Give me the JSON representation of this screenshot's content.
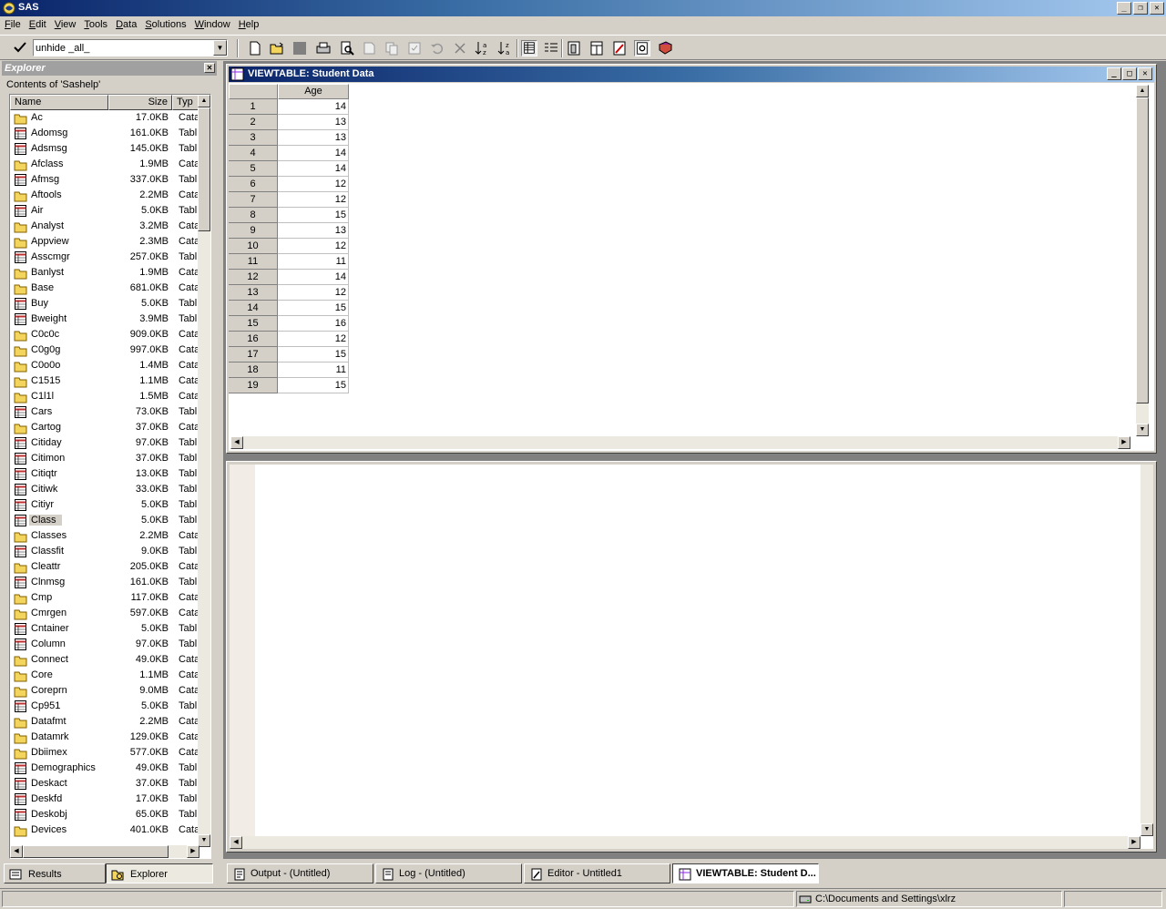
{
  "app": {
    "title": "SAS"
  },
  "menu": [
    {
      "pre": "",
      "u": "F",
      "post": "ile"
    },
    {
      "pre": "",
      "u": "E",
      "post": "dit"
    },
    {
      "pre": "",
      "u": "V",
      "post": "iew"
    },
    {
      "pre": "",
      "u": "T",
      "post": "ools"
    },
    {
      "pre": "",
      "u": "D",
      "post": "ata"
    },
    {
      "pre": "",
      "u": "S",
      "post": "olutions"
    },
    {
      "pre": "",
      "u": "W",
      "post": "indow"
    },
    {
      "pre": "",
      "u": "H",
      "post": "elp"
    }
  ],
  "command": {
    "value": "unhide _all_"
  },
  "explorer": {
    "title": "Explorer",
    "subtitle": "Contents of 'Sashelp'",
    "columns": {
      "name": "Name",
      "size": "Size",
      "type": "Typ"
    },
    "items": [
      {
        "name": "Ac",
        "size": "17.0KB",
        "type": "Cata",
        "kind": "folder"
      },
      {
        "name": "Adomsg",
        "size": "161.0KB",
        "type": "Tabl",
        "kind": "table"
      },
      {
        "name": "Adsmsg",
        "size": "145.0KB",
        "type": "Tabl",
        "kind": "table"
      },
      {
        "name": "Afclass",
        "size": "1.9MB",
        "type": "Cata",
        "kind": "folder"
      },
      {
        "name": "Afmsg",
        "size": "337.0KB",
        "type": "Tabl",
        "kind": "table"
      },
      {
        "name": "Aftools",
        "size": "2.2MB",
        "type": "Cata",
        "kind": "folder"
      },
      {
        "name": "Air",
        "size": "5.0KB",
        "type": "Tabl",
        "kind": "table"
      },
      {
        "name": "Analyst",
        "size": "3.2MB",
        "type": "Cata",
        "kind": "folder"
      },
      {
        "name": "Appview",
        "size": "2.3MB",
        "type": "Cata",
        "kind": "folder"
      },
      {
        "name": "Asscmgr",
        "size": "257.0KB",
        "type": "Tabl",
        "kind": "table"
      },
      {
        "name": "Banlyst",
        "size": "1.9MB",
        "type": "Cata",
        "kind": "folder"
      },
      {
        "name": "Base",
        "size": "681.0KB",
        "type": "Cata",
        "kind": "folder"
      },
      {
        "name": "Buy",
        "size": "5.0KB",
        "type": "Tabl",
        "kind": "table"
      },
      {
        "name": "Bweight",
        "size": "3.9MB",
        "type": "Tabl",
        "kind": "table"
      },
      {
        "name": "C0c0c",
        "size": "909.0KB",
        "type": "Cata",
        "kind": "folder"
      },
      {
        "name": "C0g0g",
        "size": "997.0KB",
        "type": "Cata",
        "kind": "folder"
      },
      {
        "name": "C0o0o",
        "size": "1.4MB",
        "type": "Cata",
        "kind": "folder"
      },
      {
        "name": "C1515",
        "size": "1.1MB",
        "type": "Cata",
        "kind": "folder"
      },
      {
        "name": "C1l1l",
        "size": "1.5MB",
        "type": "Cata",
        "kind": "folder"
      },
      {
        "name": "Cars",
        "size": "73.0KB",
        "type": "Tabl",
        "kind": "table"
      },
      {
        "name": "Cartog",
        "size": "37.0KB",
        "type": "Cata",
        "kind": "folder"
      },
      {
        "name": "Citiday",
        "size": "97.0KB",
        "type": "Tabl",
        "kind": "table"
      },
      {
        "name": "Citimon",
        "size": "37.0KB",
        "type": "Tabl",
        "kind": "table"
      },
      {
        "name": "Citiqtr",
        "size": "13.0KB",
        "type": "Tabl",
        "kind": "table"
      },
      {
        "name": "Citiwk",
        "size": "33.0KB",
        "type": "Tabl",
        "kind": "table"
      },
      {
        "name": "Citiyr",
        "size": "5.0KB",
        "type": "Tabl",
        "kind": "table"
      },
      {
        "name": "Class",
        "size": "5.0KB",
        "type": "Tabl",
        "kind": "table",
        "selected": true
      },
      {
        "name": "Classes",
        "size": "2.2MB",
        "type": "Cata",
        "kind": "folder"
      },
      {
        "name": "Classfit",
        "size": "9.0KB",
        "type": "Tabl",
        "kind": "table"
      },
      {
        "name": "Cleattr",
        "size": "205.0KB",
        "type": "Cata",
        "kind": "folder"
      },
      {
        "name": "Clnmsg",
        "size": "161.0KB",
        "type": "Tabl",
        "kind": "table"
      },
      {
        "name": "Cmp",
        "size": "117.0KB",
        "type": "Cata",
        "kind": "folder"
      },
      {
        "name": "Cmrgen",
        "size": "597.0KB",
        "type": "Cata",
        "kind": "folder"
      },
      {
        "name": "Cntainer",
        "size": "5.0KB",
        "type": "Tabl",
        "kind": "table"
      },
      {
        "name": "Column",
        "size": "97.0KB",
        "type": "Tabl",
        "kind": "table"
      },
      {
        "name": "Connect",
        "size": "49.0KB",
        "type": "Cata",
        "kind": "folder"
      },
      {
        "name": "Core",
        "size": "1.1MB",
        "type": "Cata",
        "kind": "folder"
      },
      {
        "name": "Coreprn",
        "size": "9.0MB",
        "type": "Cata",
        "kind": "folder"
      },
      {
        "name": "Cp951",
        "size": "5.0KB",
        "type": "Tabl",
        "kind": "table"
      },
      {
        "name": "Datafmt",
        "size": "2.2MB",
        "type": "Cata",
        "kind": "folder"
      },
      {
        "name": "Datamrk",
        "size": "129.0KB",
        "type": "Cata",
        "kind": "folder"
      },
      {
        "name": "Dbiimex",
        "size": "577.0KB",
        "type": "Cata",
        "kind": "folder"
      },
      {
        "name": "Demographics",
        "size": "49.0KB",
        "type": "Tabl",
        "kind": "table"
      },
      {
        "name": "Deskact",
        "size": "37.0KB",
        "type": "Tabl",
        "kind": "table"
      },
      {
        "name": "Deskfd",
        "size": "17.0KB",
        "type": "Tabl",
        "kind": "table"
      },
      {
        "name": "Deskobj",
        "size": "65.0KB",
        "type": "Tabl",
        "kind": "table"
      },
      {
        "name": "Devices",
        "size": "401.0KB",
        "type": "Cata",
        "kind": "folder"
      }
    ]
  },
  "explorer_tabs": {
    "results": "Results",
    "explorer": "Explorer"
  },
  "viewtable": {
    "title": "VIEWTABLE: Student Data",
    "column": "Age",
    "rows": [
      {
        "n": "1",
        "v": "14"
      },
      {
        "n": "2",
        "v": "13"
      },
      {
        "n": "3",
        "v": "13"
      },
      {
        "n": "4",
        "v": "14"
      },
      {
        "n": "5",
        "v": "14"
      },
      {
        "n": "6",
        "v": "12"
      },
      {
        "n": "7",
        "v": "12"
      },
      {
        "n": "8",
        "v": "15"
      },
      {
        "n": "9",
        "v": "13"
      },
      {
        "n": "10",
        "v": "12"
      },
      {
        "n": "11",
        "v": "11"
      },
      {
        "n": "12",
        "v": "14"
      },
      {
        "n": "13",
        "v": "12"
      },
      {
        "n": "14",
        "v": "15"
      },
      {
        "n": "15",
        "v": "16"
      },
      {
        "n": "16",
        "v": "12"
      },
      {
        "n": "17",
        "v": "15"
      },
      {
        "n": "18",
        "v": "11"
      },
      {
        "n": "19",
        "v": "15"
      }
    ]
  },
  "window_tabs": {
    "output": "Output - (Untitled)",
    "log": "Log - (Untitled)",
    "editor": "Editor - Untitled1",
    "viewtable": "VIEWTABLE: Student D..."
  },
  "status": {
    "path": "C:\\Documents and Settings\\xlrz"
  },
  "colors": {
    "titlebar": "#0a246a",
    "face": "#d4d0c8",
    "folder": "#f3d45c"
  }
}
